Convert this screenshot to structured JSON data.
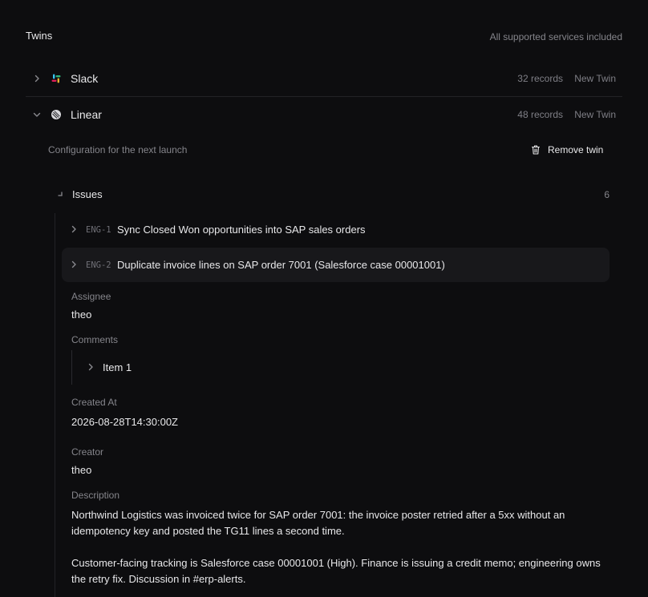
{
  "twins": {
    "title": "Twins",
    "subtitle": "All supported services included",
    "services": [
      {
        "name": "Slack",
        "records": "32 records",
        "action": "New Twin",
        "icon": "slack-icon"
      },
      {
        "name": "Linear",
        "records": "48 records",
        "action": "New Twin",
        "icon": "linear-icon"
      }
    ]
  },
  "config": {
    "note": "Configuration for the next launch",
    "remove_label": "Remove twin"
  },
  "issues": {
    "label": "Issues",
    "count": "6",
    "items": [
      {
        "code": "ENG-1",
        "title": "Sync Closed Won opportunities into SAP sales orders"
      },
      {
        "code": "ENG-2",
        "title": "Duplicate invoice lines on SAP order 7001 (Salesforce case 00001001)"
      }
    ]
  },
  "detail": {
    "assignee_label": "Assignee",
    "assignee": "theo",
    "comments_label": "Comments",
    "comment_item": "Item 1",
    "created_label": "Created At",
    "created": "2026-08-28T14:30:00Z",
    "creator_label": "Creator",
    "creator": "theo",
    "description_label": "Description",
    "description_p1": "Northwind Logistics was invoiced twice for SAP order 7001: the invoice poster retried after a 5xx without an idempotency key and posted the TG11 lines a second time.",
    "description_p2": "Customer-facing tracking is Salesforce case 00001001 (High). Finance is issuing a credit memo; engineering owns the retry fix. Discussion in #erp-alerts."
  },
  "colors": {
    "background": "#0d0d0f",
    "selected_row": "#18181b",
    "muted_text": "#85858b"
  }
}
